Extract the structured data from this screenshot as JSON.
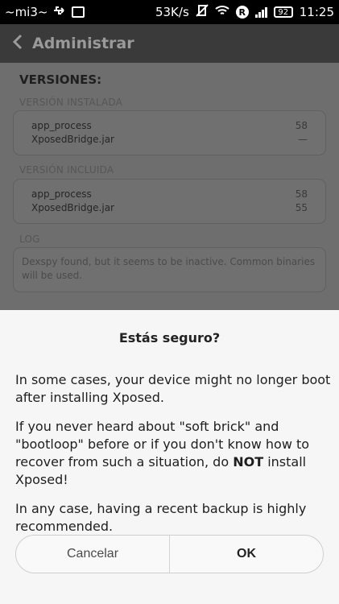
{
  "status_bar": {
    "carrier": "~mi3~",
    "speed": "53K/s",
    "battery": "92",
    "time": "11:25",
    "icons": [
      "usb-icon",
      "image-icon",
      "vibrate-off-icon",
      "wifi-icon",
      "r-badge-icon",
      "signal-icon",
      "battery-icon"
    ]
  },
  "app_bar": {
    "title": "Administrar"
  },
  "content": {
    "heading": "VERSIONES:",
    "installed_caption": "VERSIÓN INSTALADA",
    "installed_rows": [
      {
        "name": "app_process",
        "value": "58"
      },
      {
        "name": "XposedBridge.jar",
        "value": "—"
      }
    ],
    "included_caption": "VERSIÓN INCLUIDA",
    "included_rows": [
      {
        "name": "app_process",
        "value": "58"
      },
      {
        "name": "XposedBridge.jar",
        "value": "55"
      }
    ],
    "log_caption": "LOG",
    "log_text": "Dexspy found, but it seems to be inactive. Common binaries will be used."
  },
  "dialog": {
    "title": "Estás seguro?",
    "paragraph1": "In some cases, your device might no longer boot after installing Xposed.",
    "paragraph2_pre": "If you never heard about \"soft brick\" and \"bootloop\" before or if you don't know how to recover from such a situation, do ",
    "paragraph2_bold": "NOT",
    "paragraph2_post": " install Xposed!",
    "paragraph3": "In any case, having a recent backup is highly recommended.",
    "cancel_label": "Cancelar",
    "ok_label": "OK"
  }
}
